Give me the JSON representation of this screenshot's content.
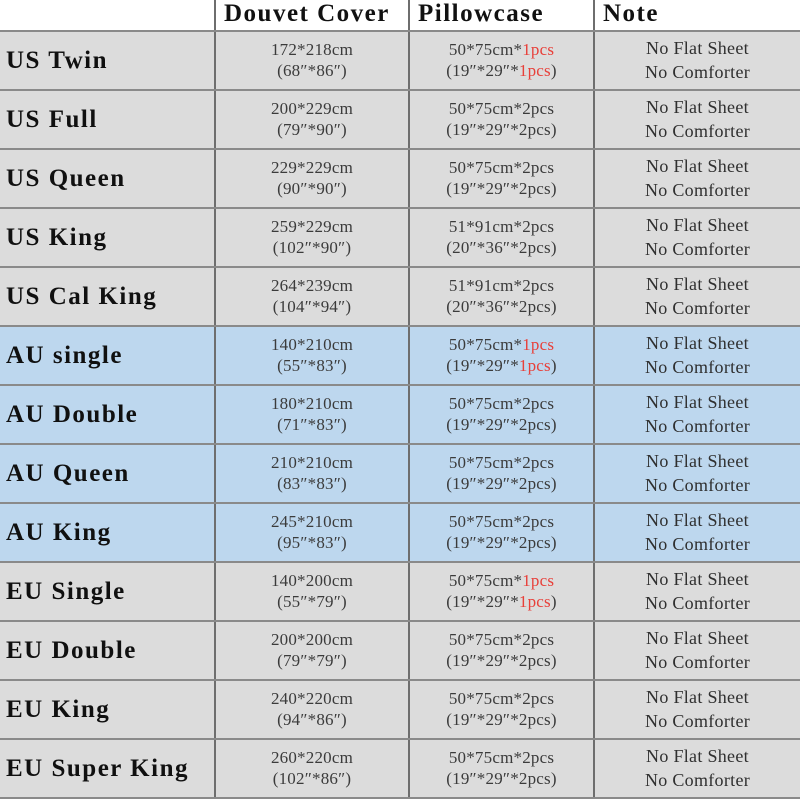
{
  "table": {
    "headers": {
      "size": "",
      "duvet": "Douvet Cover",
      "pillowcase": "Pillowcase",
      "note": "Note"
    },
    "colors": {
      "row_gray": "#dcdcdc",
      "row_blue": "#bdd7ee",
      "highlight_red": "#e8403a",
      "grid_line": "#6e6e6e",
      "text": "#2f2f2f"
    },
    "rows": [
      {
        "size": "US Twin",
        "tone": "gray",
        "duvet_cm": "172*218cm",
        "duvet_in": "(68″*86″)",
        "pillow_cm_prefix": "50*75cm*",
        "pillow_cm_qty": "1pcs",
        "pillow_qty_red": true,
        "pillow_in_prefix": "(19″*29″*",
        "pillow_in_qty": "1pcs",
        "pillow_in_suffix": ")",
        "note_line1": "No Flat Sheet",
        "note_line2": "No Comforter"
      },
      {
        "size": "US Full",
        "tone": "gray",
        "duvet_cm": "200*229cm",
        "duvet_in": "(79″*90″)",
        "pillow_cm_prefix": "50*75cm*",
        "pillow_cm_qty": "2pcs",
        "pillow_qty_red": false,
        "pillow_in_prefix": "(19″*29″*",
        "pillow_in_qty": "2pcs",
        "pillow_in_suffix": ")",
        "note_line1": "No Flat Sheet",
        "note_line2": "No Comforter"
      },
      {
        "size": "US Queen",
        "tone": "gray",
        "duvet_cm": "229*229cm",
        "duvet_in": "(90″*90″)",
        "pillow_cm_prefix": "50*75cm*",
        "pillow_cm_qty": "2pcs",
        "pillow_qty_red": false,
        "pillow_in_prefix": "(19″*29″*",
        "pillow_in_qty": "2pcs",
        "pillow_in_suffix": ")",
        "note_line1": "No Flat Sheet",
        "note_line2": "No Comforter"
      },
      {
        "size": "US King",
        "tone": "gray",
        "duvet_cm": "259*229cm",
        "duvet_in": "(102″*90″)",
        "pillow_cm_prefix": "51*91cm*",
        "pillow_cm_qty": "2pcs",
        "pillow_qty_red": false,
        "pillow_in_prefix": "(20″*36″*",
        "pillow_in_qty": "2pcs",
        "pillow_in_suffix": ")",
        "note_line1": "No Flat Sheet",
        "note_line2": "No Comforter"
      },
      {
        "size": "US Cal King",
        "tone": "gray",
        "duvet_cm": "264*239cm",
        "duvet_in": "(104″*94″)",
        "pillow_cm_prefix": "51*91cm*",
        "pillow_cm_qty": "2pcs",
        "pillow_qty_red": false,
        "pillow_in_prefix": "(20″*36″*",
        "pillow_in_qty": "2pcs",
        "pillow_in_suffix": ")",
        "note_line1": "No Flat Sheet",
        "note_line2": "No Comforter"
      },
      {
        "size": "AU single",
        "tone": "blue",
        "duvet_cm": "140*210cm",
        "duvet_in": "(55″*83″)",
        "pillow_cm_prefix": "50*75cm*",
        "pillow_cm_qty": "1pcs",
        "pillow_qty_red": true,
        "pillow_in_prefix": "(19″*29″*",
        "pillow_in_qty": "1pcs",
        "pillow_in_suffix": ")",
        "note_line1": "No Flat Sheet",
        "note_line2": "No Comforter"
      },
      {
        "size": "AU Double",
        "tone": "blue",
        "duvet_cm": "180*210cm",
        "duvet_in": "(71″*83″)",
        "pillow_cm_prefix": "50*75cm*",
        "pillow_cm_qty": "2pcs",
        "pillow_qty_red": false,
        "pillow_in_prefix": "(19″*29″*",
        "pillow_in_qty": "2pcs",
        "pillow_in_suffix": ")",
        "note_line1": "No Flat Sheet",
        "note_line2": "No Comforter"
      },
      {
        "size": "AU Queen",
        "tone": "blue",
        "duvet_cm": "210*210cm",
        "duvet_in": "(83″*83″)",
        "pillow_cm_prefix": "50*75cm*",
        "pillow_cm_qty": "2pcs",
        "pillow_qty_red": false,
        "pillow_in_prefix": "(19″*29″*",
        "pillow_in_qty": "2pcs",
        "pillow_in_suffix": ")",
        "note_line1": "No Flat Sheet",
        "note_line2": "No Comforter"
      },
      {
        "size": "AU King",
        "tone": "blue",
        "duvet_cm": "245*210cm",
        "duvet_in": "(95″*83″)",
        "pillow_cm_prefix": "50*75cm*",
        "pillow_cm_qty": "2pcs",
        "pillow_qty_red": false,
        "pillow_in_prefix": "(19″*29″*",
        "pillow_in_qty": "2pcs",
        "pillow_in_suffix": ")",
        "note_line1": "No Flat Sheet",
        "note_line2": "No Comforter"
      },
      {
        "size": "EU Single",
        "tone": "gray",
        "duvet_cm": "140*200cm",
        "duvet_in": "(55″*79″)",
        "pillow_cm_prefix": "50*75cm*",
        "pillow_cm_qty": "1pcs",
        "pillow_qty_red": true,
        "pillow_in_prefix": "(19″*29″*",
        "pillow_in_qty": "1pcs",
        "pillow_in_suffix": ")",
        "note_line1": "No Flat Sheet",
        "note_line2": "No Comforter"
      },
      {
        "size": "EU Double",
        "tone": "gray",
        "duvet_cm": "200*200cm",
        "duvet_in": "(79″*79″)",
        "pillow_cm_prefix": "50*75cm*",
        "pillow_cm_qty": "2pcs",
        "pillow_qty_red": false,
        "pillow_in_prefix": "(19″*29″*",
        "pillow_in_qty": "2pcs",
        "pillow_in_suffix": ")",
        "note_line1": "No Flat Sheet",
        "note_line2": "No Comforter"
      },
      {
        "size": "EU King",
        "tone": "gray",
        "duvet_cm": "240*220cm",
        "duvet_in": "(94″*86″)",
        "pillow_cm_prefix": "50*75cm*",
        "pillow_cm_qty": "2pcs",
        "pillow_qty_red": false,
        "pillow_in_prefix": "(19″*29″*",
        "pillow_in_qty": "2pcs",
        "pillow_in_suffix": ")",
        "note_line1": "No Flat Sheet",
        "note_line2": "No Comforter"
      },
      {
        "size": "EU Super King",
        "tone": "gray",
        "duvet_cm": "260*220cm",
        "duvet_in": "(102″*86″)",
        "pillow_cm_prefix": "50*75cm*",
        "pillow_cm_qty": "2pcs",
        "pillow_qty_red": false,
        "pillow_in_prefix": "(19″*29″*",
        "pillow_in_qty": "2pcs",
        "pillow_in_suffix": ")",
        "note_line1": "No Flat Sheet",
        "note_line2": "No Comforter"
      }
    ]
  }
}
